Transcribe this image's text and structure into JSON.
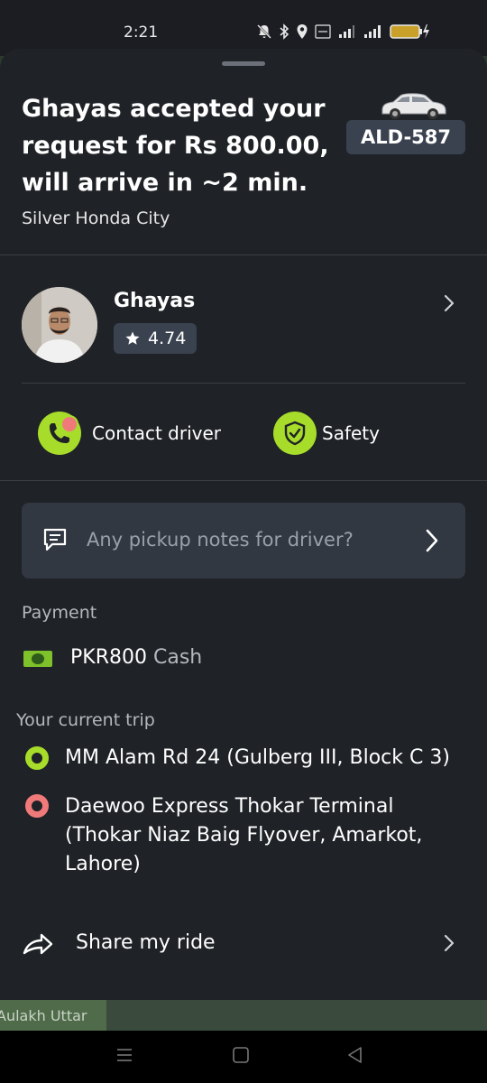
{
  "status_bar": {
    "time": "2:21",
    "battery": "73"
  },
  "ride": {
    "headline": "Ghayas accepted your request for Rs 800.00, will arrive in ~2 min.",
    "vehicle": "Silver Honda City",
    "plate": "ALD-587"
  },
  "driver": {
    "name": "Ghayas",
    "rating": "4.74"
  },
  "actions": {
    "contact": "Contact driver",
    "safety": "Safety"
  },
  "notes": {
    "placeholder": "Any pickup notes for driver?"
  },
  "payment": {
    "label": "Payment",
    "amount": "PKR800",
    "method": "Cash"
  },
  "trip": {
    "label": "Your current trip",
    "pickup": "MM Alam Rd 24 (Gulberg III, Block C 3)",
    "dropoff": "Daewoo Express Thokar Terminal (Thokar Niaz Baig Flyover, Amarkot, Lahore)"
  },
  "share": {
    "label": "Share my ride"
  },
  "map": {
    "label": "Aulakh Uttar"
  },
  "colors": {
    "accent": "#a7dc2a",
    "dropoff": "#f07a7a",
    "sheet": "#1f2226",
    "chip": "#3a4250"
  }
}
